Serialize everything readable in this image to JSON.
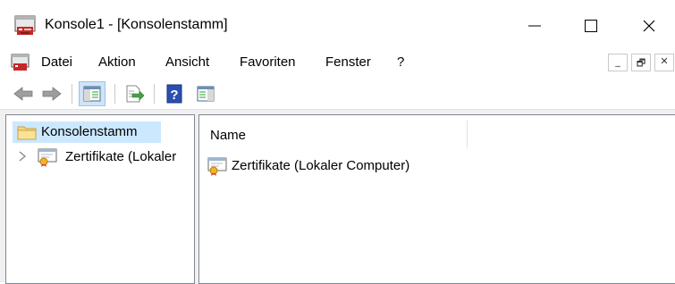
{
  "window": {
    "title": "Konsole1 - [Konsolenstamm]",
    "controls": [
      "minimize",
      "maximize",
      "close"
    ]
  },
  "menu": {
    "items": [
      "Datei",
      "Aktion",
      "Ansicht",
      "Favoriten",
      "Fenster",
      "?"
    ],
    "mdi_controls": [
      "_",
      "🗗",
      "✕"
    ]
  },
  "toolbar": {
    "buttons": [
      "back-arrow-icon",
      "forward-arrow-icon",
      "show-hide-console-tree-icon",
      "export-list-icon",
      "help-icon",
      "show-hide-action-pane-icon"
    ]
  },
  "tree": {
    "root": "Konsolenstamm",
    "child": "Zertifikate (Lokaler"
  },
  "list": {
    "column_header": "Name",
    "rows": [
      "Zertifikate (Lokaler Computer)"
    ]
  },
  "colors": {
    "selection": "#cce8ff",
    "toolbar_active": "#cfe4f7",
    "pane_border": "#828790"
  }
}
